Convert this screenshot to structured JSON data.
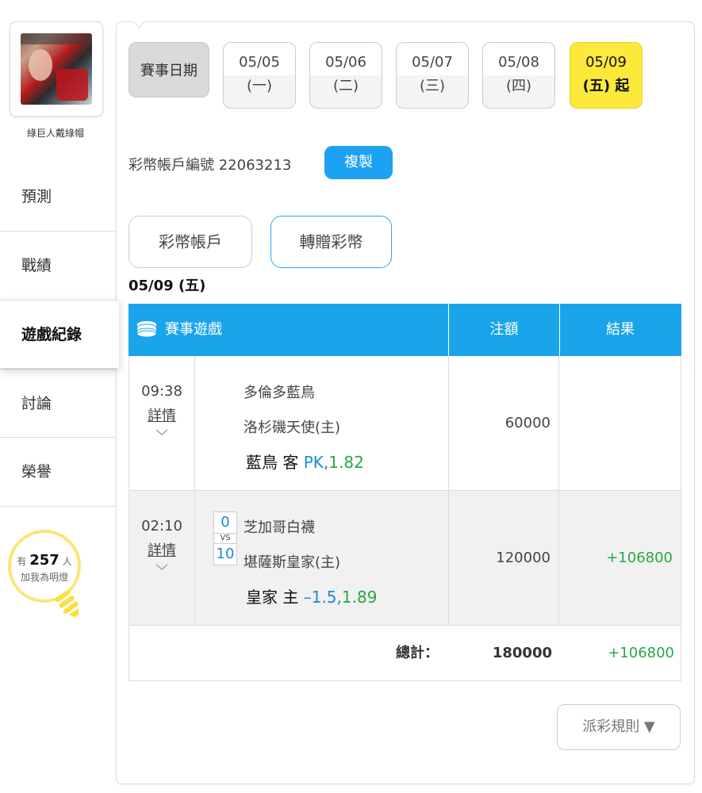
{
  "sidebar": {
    "username": "綠巨人戴綠帽",
    "items": [
      {
        "label": "預測"
      },
      {
        "label": "戰績"
      },
      {
        "label": "遊戲紀錄"
      },
      {
        "label": "討論"
      },
      {
        "label": "榮譽"
      }
    ],
    "bulb": {
      "prefix": "有",
      "count": "257",
      "suffix": "人",
      "caption": "加我為明燈"
    }
  },
  "dates": {
    "label": "賽事日期",
    "items": [
      {
        "date": "05/05",
        "day": "(一)"
      },
      {
        "date": "05/06",
        "day": "(二)"
      },
      {
        "date": "05/07",
        "day": "(三)"
      },
      {
        "date": "05/08",
        "day": "(四)"
      },
      {
        "date": "05/09",
        "day": "(五) 起"
      }
    ]
  },
  "account": {
    "label": "彩幣帳戶編號",
    "number": "22063213",
    "copy_label": "複製"
  },
  "tabs": [
    {
      "label": "彩幣帳戶"
    },
    {
      "label": "轉贈彩幣"
    }
  ],
  "date_heading": "05/09 (五)",
  "table": {
    "headers": {
      "game": "賽事遊戲",
      "amount": "注額",
      "result": "結果"
    },
    "rows": [
      {
        "time": "09:38",
        "detail": "詳情",
        "team1": "多倫多藍鳥",
        "team2": "洛杉磯天使(主)",
        "pick_team": "藍鳥 客",
        "pick_line": "PK,",
        "pick_odds": "1.82",
        "amount": "60000",
        "result": ""
      },
      {
        "time": "02:10",
        "detail": "詳情",
        "score_away": "0",
        "score_vs": "VS",
        "score_home": "10",
        "team1": "芝加哥白襪",
        "team2": "堪薩斯皇家(主)",
        "pick_team": "皇家 主",
        "pick_line": "–1.5,",
        "pick_odds": "1.89",
        "amount": "120000",
        "result": "+106800"
      }
    ],
    "total": {
      "label": "總計：",
      "amount": "180000",
      "result": "+106800"
    }
  },
  "payout_rules": "派彩規則 ▼",
  "colors": {
    "accent": "#1aa4ea",
    "highlight": "#fde93c",
    "positive": "#28a745"
  }
}
